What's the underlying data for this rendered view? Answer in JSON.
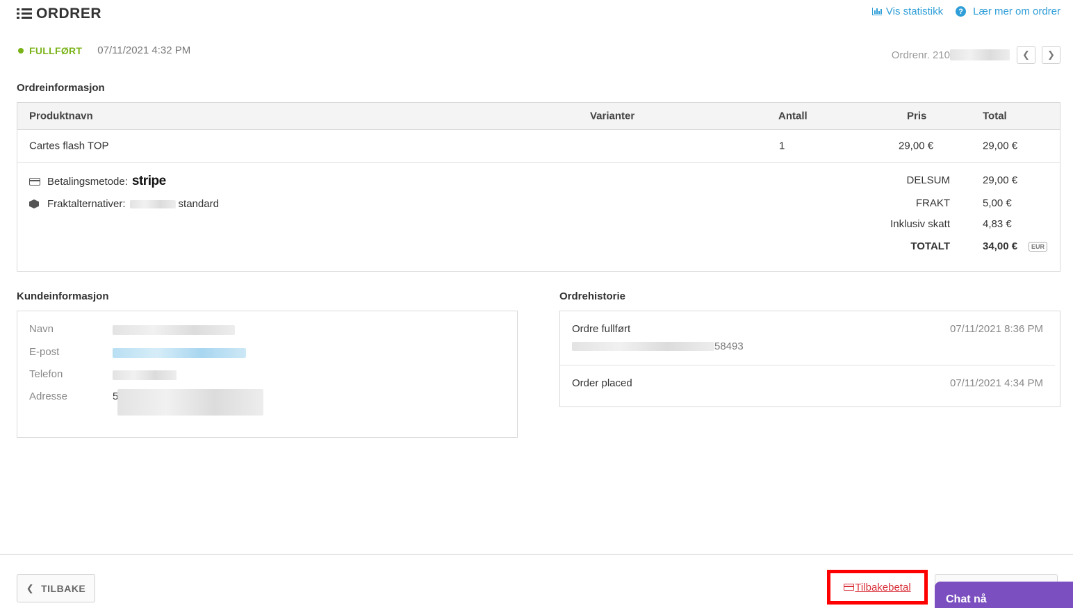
{
  "header": {
    "title": "ORDRER",
    "links": {
      "stats": "Vis statistikk",
      "learn": "Lær mer om ordrer"
    }
  },
  "status": {
    "label": "FULLFØRT",
    "date": "07/11/2021 4:32 PM",
    "color": "#7ab317"
  },
  "order_nav": {
    "number_label": "Ordrenr. 210",
    "prev_icon": "chevron-left-icon",
    "next_icon": "chevron-right-icon"
  },
  "order_info": {
    "title": "Ordreinformasjon",
    "columns": [
      "Produktnavn",
      "Varianter",
      "Antall",
      "Pris",
      "Total"
    ],
    "rows": [
      {
        "product": "Cartes flash TOP",
        "variants": "",
        "qty": "1",
        "price": "29,00 €",
        "total": "29,00 €"
      }
    ],
    "payment_label": "Betalingsmetode:",
    "payment_provider": "stripe",
    "shipping_label": "Fraktalternativer:",
    "shipping_value": "standard",
    "summary": [
      {
        "label": "DELSUM",
        "value": "29,00 €"
      },
      {
        "label": "FRAKT",
        "value": "5,00 €"
      },
      {
        "label": "Inklusiv skatt",
        "value": "4,83 €"
      },
      {
        "label": "TOTALT",
        "value": "34,00 €"
      }
    ],
    "currency_badge": "EUR"
  },
  "customer": {
    "title": "Kundeinformasjon",
    "fields": [
      "Navn",
      "E-post",
      "Telefon",
      "Adresse"
    ],
    "address_prefix": "5"
  },
  "history": {
    "title": "Ordrehistorie",
    "items": [
      {
        "title": "Ordre fullført",
        "date": "07/11/2021 8:36 PM",
        "detail_suffix": "58493"
      },
      {
        "title": "Order placed",
        "date": "07/11/2021 4:34 PM"
      }
    ]
  },
  "footer": {
    "back_label": "TILBAKE",
    "refund_label": "Tilbakebetal",
    "chat_label": "Chat nå"
  },
  "colors": {
    "link": "#2f9ed8",
    "refund": "#d9313a",
    "highlight": "#ff0000",
    "chat": "#7b4fbf"
  }
}
